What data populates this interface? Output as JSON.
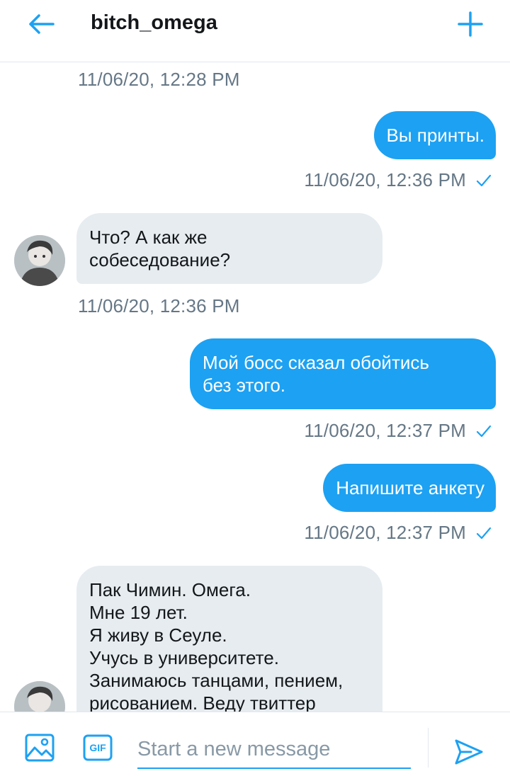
{
  "header": {
    "title": "bitch_omega",
    "back_icon": "arrow-left-icon",
    "new_icon": "plus-icon"
  },
  "messages": [
    {
      "direction": "meta",
      "timestamp": "11/06/20, 12:28 PM"
    },
    {
      "direction": "out",
      "lines": [
        "Вы принты."
      ],
      "timestamp": "11/06/20, 12:36 PM",
      "read_icon": "checkmark-icon"
    },
    {
      "direction": "in",
      "lines": [
        "Что? А как же",
        "собеседование?"
      ],
      "timestamp": "11/06/20, 12:36 PM"
    },
    {
      "direction": "out",
      "lines": [
        "Мой босс сказал обойтись",
        "без этого."
      ],
      "timestamp": "11/06/20, 12:37 PM",
      "read_icon": "checkmark-icon"
    },
    {
      "direction": "out",
      "lines": [
        "Напишите анкету"
      ],
      "timestamp": "11/06/20, 12:37 PM",
      "read_icon": "checkmark-icon"
    },
    {
      "direction": "in",
      "lines": [
        "Пак Чимин. Омега.",
        "Мне 19 лет.",
        "Я живу в Сеуле.",
        "Учусь в университете.",
        "Занимаюсь танцами, пением,",
        "рисованием. Веду твиттер"
      ]
    }
  ],
  "composer": {
    "placeholder": "Start a new message",
    "media_icon": "image-icon",
    "gif_label": "GIF",
    "send_icon": "send-icon"
  },
  "colors": {
    "accent": "#1da1f2",
    "incoming_bubble": "#e6ecf0",
    "timestamp": "#657786",
    "text": "#14171a"
  }
}
